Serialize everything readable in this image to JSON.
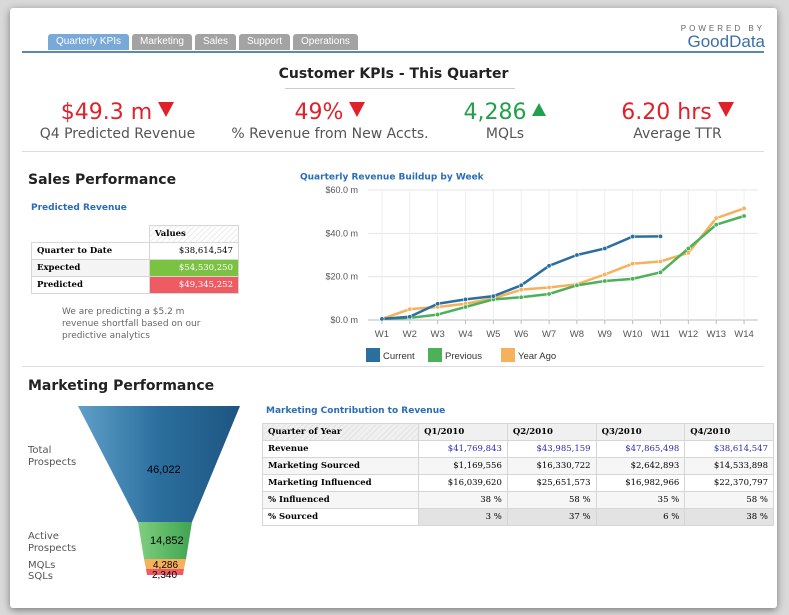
{
  "tabs": [
    "Quarterly KPIs",
    "Marketing",
    "Sales",
    "Support",
    "Operations"
  ],
  "powered_by": {
    "line1": "POWERED BY",
    "line2": "GoodData"
  },
  "page_title": "Customer KPIs - This Quarter",
  "kpis": [
    {
      "value": "$49.3 m",
      "label": "Q4 Predicted Revenue",
      "trend": "down"
    },
    {
      "value": "49%",
      "label": "% Revenue from New Accts.",
      "trend": "down"
    },
    {
      "value": "4,286",
      "label": "MQLs",
      "trend": "up"
    },
    {
      "value": "6.20 hrs",
      "label": "Average TTR",
      "trend": "down"
    }
  ],
  "colors": {
    "red": "#e0202a",
    "green": "#22a04b",
    "current": "#2a6f9e",
    "previous": "#4db15a",
    "year_ago": "#f5b15b",
    "expected_bg": "#7cc242",
    "predicted_bg": "#ef5b63"
  },
  "sales": {
    "title": "Sales Performance",
    "predicted_title": "Predicted Revenue",
    "col_header": "Values",
    "rows": [
      {
        "label": "Quarter to Date",
        "value": "$38,614,547"
      },
      {
        "label": "Expected",
        "value": "$54,530,250"
      },
      {
        "label": "Predicted",
        "value": "$49,345,252"
      }
    ],
    "note": "We are predicting a $5.2 m revenue shortfall based on our predictive analytics"
  },
  "chart_data": {
    "type": "line",
    "title": "Quarterly Revenue Buildup by Week",
    "categories": [
      "W1",
      "W2",
      "W3",
      "W4",
      "W5",
      "W6",
      "W7",
      "W8",
      "W9",
      "W10",
      "W11",
      "W12",
      "W13",
      "W14"
    ],
    "y_ticks": [
      "$0.0 m",
      "$20.0 m",
      "$40.0 m",
      "$60.0 m"
    ],
    "ylim": [
      0,
      60
    ],
    "legend_position": "bottom",
    "series": [
      {
        "name": "Current",
        "values": [
          0.5,
          1.5,
          7.5,
          9.5,
          11,
          16,
          25,
          30,
          33,
          38.5,
          38.6
        ]
      },
      {
        "name": "Previous",
        "values": [
          0.5,
          1,
          2.5,
          6,
          9.5,
          10.5,
          12,
          16,
          18,
          19,
          22,
          33,
          44,
          48
        ]
      },
      {
        "name": "Year Ago",
        "values": [
          0.5,
          5,
          6,
          7.5,
          10,
          14,
          15,
          16.5,
          21,
          26,
          27,
          31,
          47,
          51.5
        ]
      }
    ]
  },
  "marketing": {
    "title": "Marketing Performance",
    "funnel": [
      {
        "label": "Total Prospects",
        "value": "46,022"
      },
      {
        "label": "Active Prospects",
        "value": "14,852"
      },
      {
        "label": "MQLs",
        "value": "4,286"
      },
      {
        "label": "SQLs",
        "value": "2,340"
      }
    ],
    "table_title": "Marketing Contribution to Revenue",
    "headers": [
      "Quarter of Year",
      "Q1/2010",
      "Q2/2010",
      "Q3/2010",
      "Q4/2010"
    ],
    "rows": [
      [
        "Revenue",
        "$41,769,843",
        "$43,985,159",
        "$47,865,498",
        "$38,614,547"
      ],
      [
        "Marketing Sourced",
        "$1,169,556",
        "$16,330,722",
        "$2,642,893",
        "$14,533,898"
      ],
      [
        "Marketing Influenced",
        "$16,039,620",
        "$25,651,573",
        "$16,982,966",
        "$22,370,797"
      ],
      [
        "% Influenced",
        "38 %",
        "58 %",
        "35 %",
        "58 %"
      ],
      [
        "% Sourced",
        "3 %",
        "37 %",
        "6 %",
        "38 %"
      ]
    ]
  }
}
